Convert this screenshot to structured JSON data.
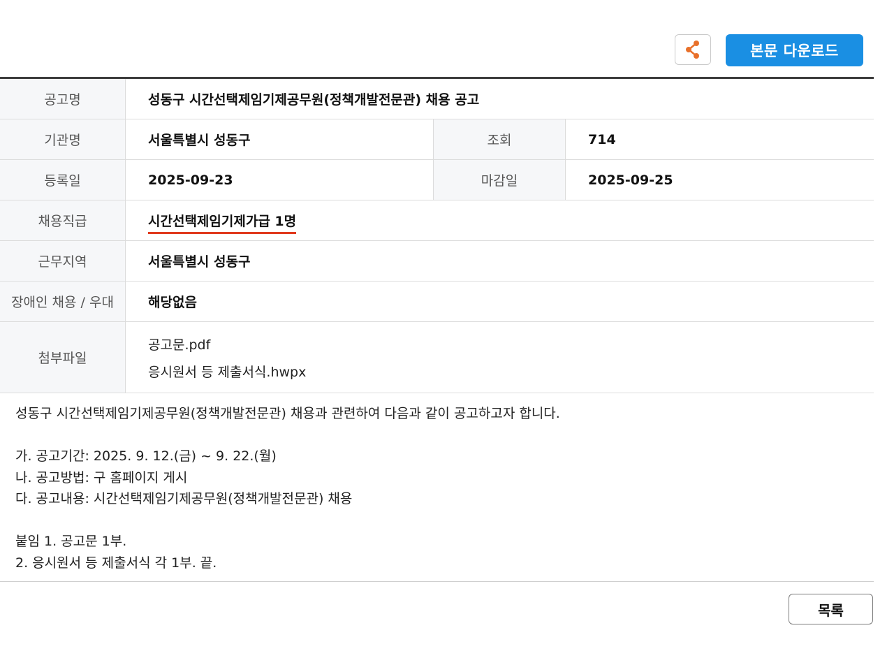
{
  "actions": {
    "share_icon": "share-icon",
    "download_label": "본문 다운로드",
    "accent_color": "#1a8fe3"
  },
  "info": {
    "title_label": "공고명",
    "title_value": "성동구 시간선택제임기제공무원(정책개발전문관) 채용 공고",
    "agency_label": "기관명",
    "agency_value": "서울특별시 성동구",
    "views_label": "조회",
    "views_value": "714",
    "registered_label": "등록일",
    "registered_value": "2025-09-23",
    "deadline_label": "마감일",
    "deadline_value": "2025-09-25",
    "grade_label": "채용직급",
    "grade_value": "시간선택제임기제가급 1명",
    "location_label": "근무지역",
    "location_value": "서울특별시 성동구",
    "disability_label": "장애인 채용 / 우대",
    "disability_value": "해당없음",
    "attachments_label": "첨부파일",
    "attachments": [
      "공고문.pdf",
      "응시원서 등 제출서식.hwpx"
    ]
  },
  "body": {
    "lines": [
      "성동구 시간선택제임기제공무원(정책개발전문관) 채용과 관련하여 다음과 같이 공고하고자 합니다.",
      "",
      "가. 공고기간: 2025. 9. 12.(금) ~ 9. 22.(월)",
      "나. 공고방법: 구 홈페이지 게시",
      "다. 공고내용: 시간선택제임기제공무원(정책개발전문관) 채용",
      "",
      "붙임 1. 공고문 1부.",
      "2. 응시원서 등 제출서식 각 1부. 끝."
    ]
  },
  "footer": {
    "list_label": "목록"
  }
}
